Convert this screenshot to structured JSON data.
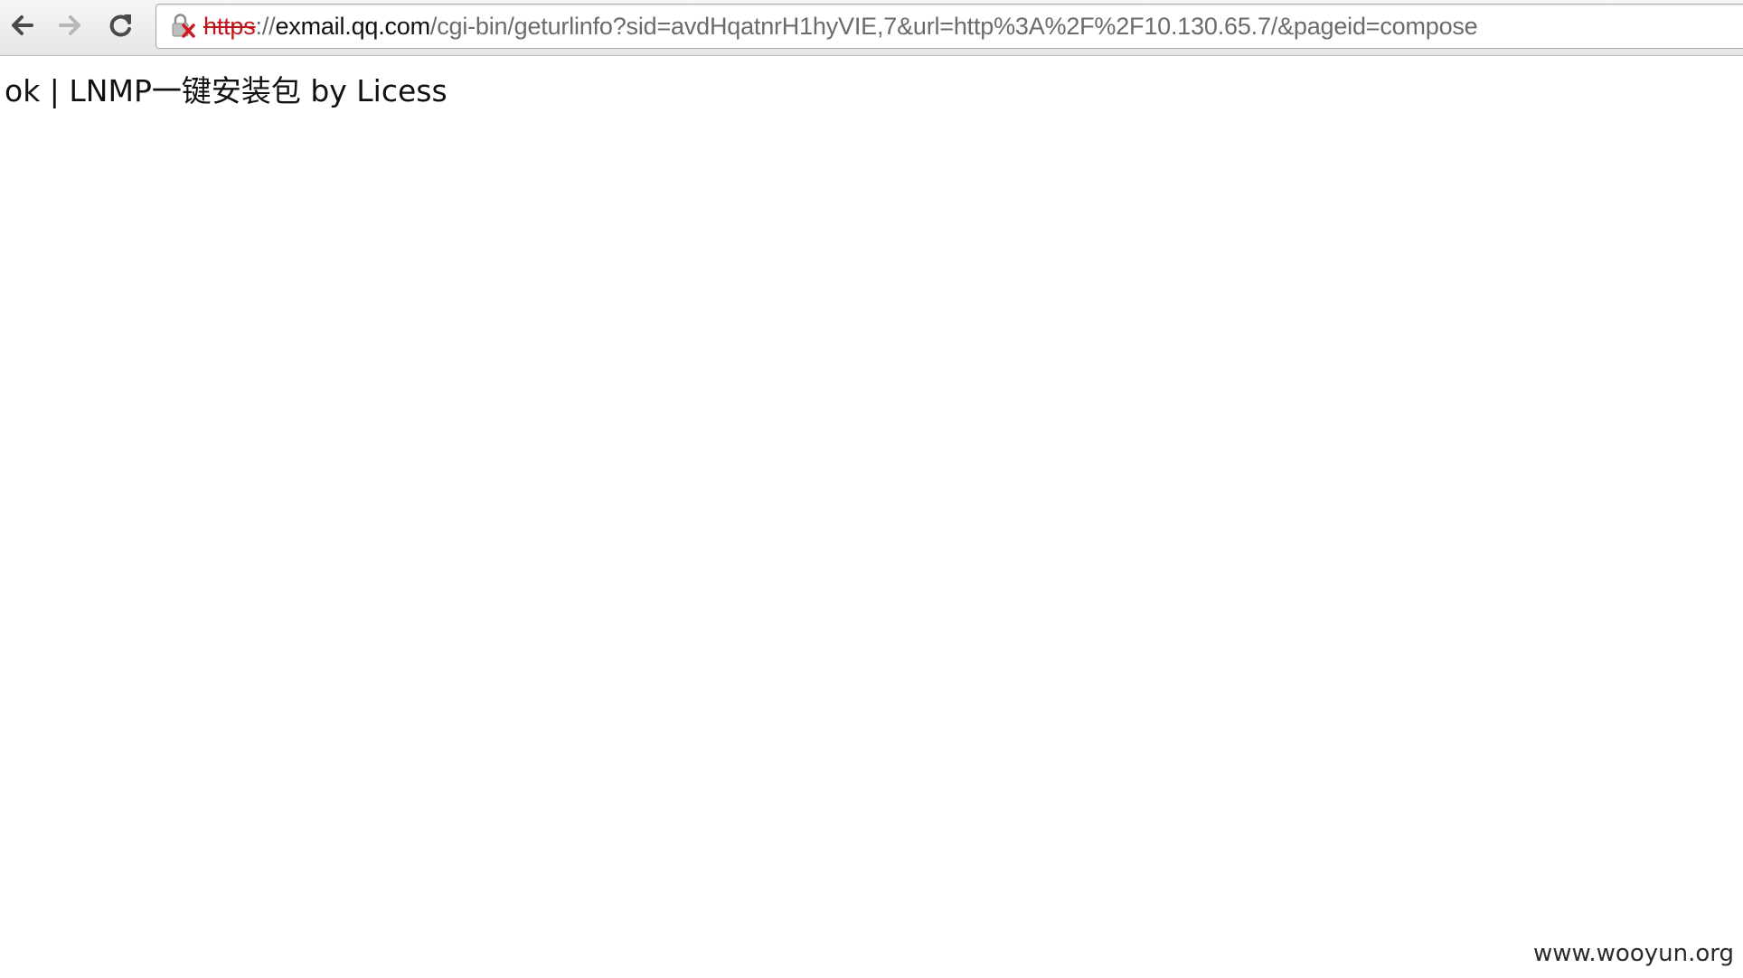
{
  "browser": {
    "url": {
      "scheme": "https",
      "separator": "://",
      "host": "exmail.qq.com",
      "path": "/cgi-bin/geturlinfo?sid=avdHqatnrH1hyVIE,7&url=http%3A%2F%2F10.130.65.7/&pageid=compose"
    },
    "icons": {
      "back": "back-arrow-icon",
      "forward": "forward-arrow-icon",
      "reload": "reload-icon",
      "security": "broken-lock-icon"
    },
    "colors": {
      "insecure_scheme": "#c0151a"
    }
  },
  "page": {
    "body_text": "ok | LNMP一键安装包 by Licess"
  },
  "watermark": {
    "text": "www.wooyun.org"
  }
}
